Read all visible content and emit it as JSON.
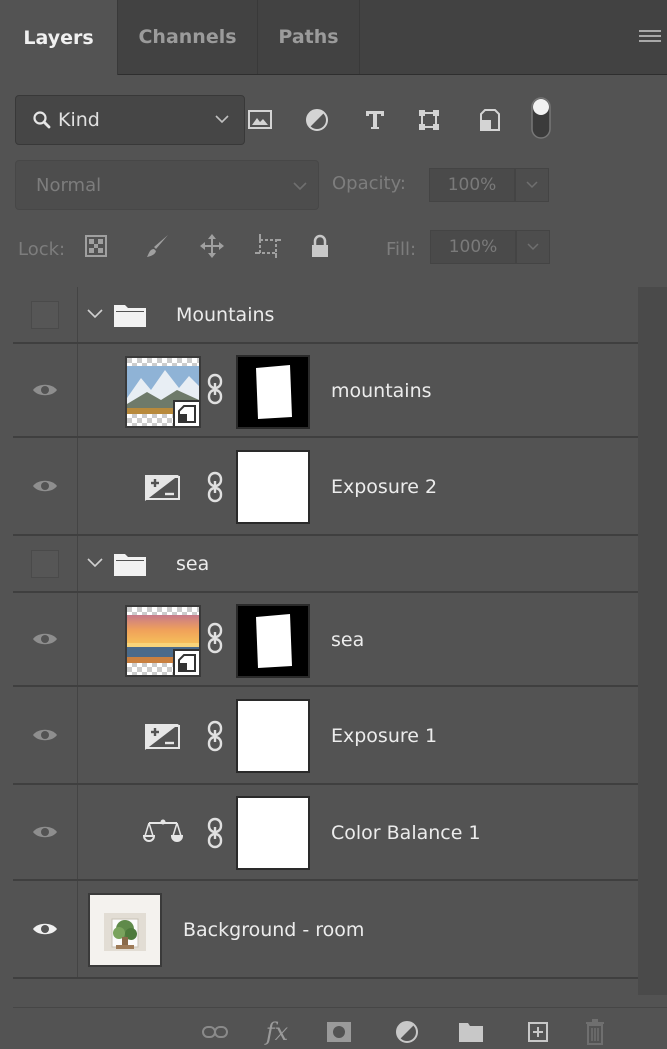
{
  "tabs": [
    {
      "label": "Layers",
      "active": true
    },
    {
      "label": "Channels",
      "active": false
    },
    {
      "label": "Paths",
      "active": false
    }
  ],
  "filter": {
    "kind_label": "Kind",
    "icons": [
      "pixel-filter-icon",
      "adjustment-filter-icon",
      "type-filter-icon",
      "shape-filter-icon",
      "smart-object-filter-icon"
    ]
  },
  "blend": {
    "mode": "Normal",
    "opacity_label": "Opacity:",
    "opacity_value": "100%"
  },
  "lock": {
    "label": "Lock:",
    "fill_label": "Fill:",
    "fill_value": "100%"
  },
  "layers": [
    {
      "name": "Mountains",
      "type": "group",
      "visible": false,
      "expanded": true
    },
    {
      "name": "mountains",
      "type": "smart-object",
      "visible": true,
      "has_mask": true
    },
    {
      "name": "Exposure 2",
      "type": "adjustment",
      "adjustment": "exposure",
      "visible": true
    },
    {
      "name": "sea",
      "type": "group",
      "visible": false,
      "expanded": true
    },
    {
      "name": "sea",
      "type": "smart-object",
      "visible": true,
      "has_mask": true
    },
    {
      "name": "Exposure 1",
      "type": "adjustment",
      "adjustment": "exposure",
      "visible": true
    },
    {
      "name": "Color Balance 1",
      "type": "adjustment",
      "adjustment": "color-balance",
      "visible": true
    },
    {
      "name": "Background - room",
      "type": "background",
      "visible": true
    }
  ],
  "colors": {
    "panel_bg": "#535353",
    "tabbar_bg": "#424242",
    "text": "#ececec",
    "dim_text": "#7d7d7d",
    "icon": "#c8c8c8"
  }
}
